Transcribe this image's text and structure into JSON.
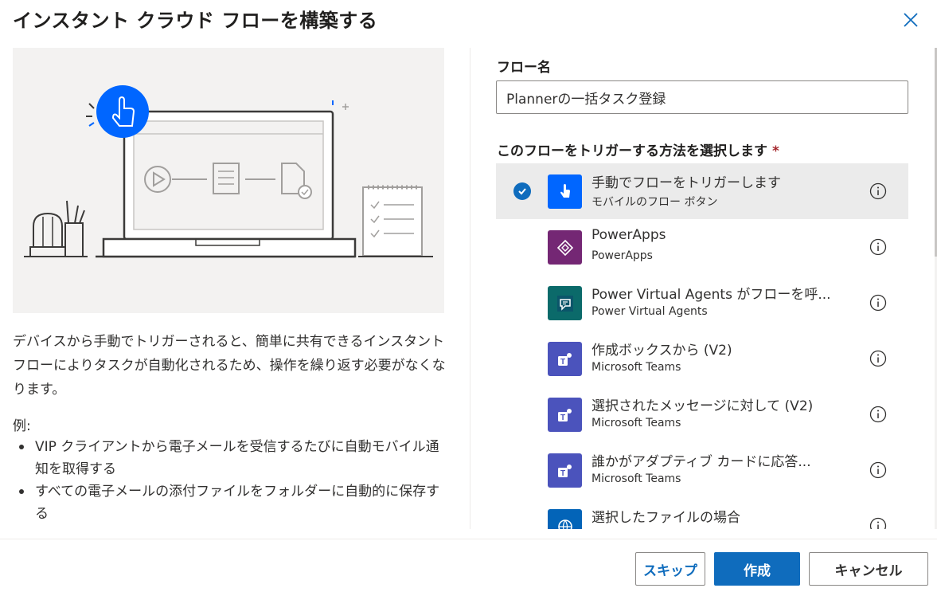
{
  "dialog": {
    "title": "インスタント クラウド フローを構築する",
    "close_icon": "close-icon"
  },
  "left": {
    "description": "デバイスから手動でトリガーされると、簡単に共有できるインスタント フローによりタスクが自動化されるため、操作を繰り返す必要がなくなります。",
    "examples_label": "例:",
    "examples": [
      "VIP クライアントから電子メールを受信するたびに自動モバイル通知を取得する",
      "すべての電子メールの添付ファイルをフォルダーに自動的に保存する"
    ]
  },
  "form": {
    "flow_name_label": "フロー名",
    "flow_name_value": "Plannerの一括タスク登録",
    "trigger_label": "このフローをトリガーする方法を選択します",
    "required_mark": "*"
  },
  "triggers": [
    {
      "title": "手動でフローをトリガーします",
      "subtitle": "モバイルのフロー ボタン",
      "icon": "touch-icon",
      "color": "#0066ff",
      "selected": true
    },
    {
      "title": "PowerApps",
      "subtitle": "PowerApps",
      "icon": "powerapps-icon",
      "color": "#742774",
      "selected": false
    },
    {
      "title": "Power Virtual Agents がフローを呼...",
      "subtitle": "Power Virtual Agents",
      "icon": "chat-bot-icon",
      "color": "#0b6a6a",
      "selected": false
    },
    {
      "title": "作成ボックスから (V2)",
      "subtitle": "Microsoft Teams",
      "icon": "teams-icon",
      "color": "#4b53bc",
      "selected": false
    },
    {
      "title": "選択されたメッセージに対して (V2)",
      "subtitle": "Microsoft Teams",
      "icon": "teams-icon",
      "color": "#4b53bc",
      "selected": false
    },
    {
      "title": "誰かがアダプティブ カードに応答...",
      "subtitle": "Microsoft Teams",
      "icon": "teams-icon",
      "color": "#4b53bc",
      "selected": false
    },
    {
      "title": "選択したファイルの場合",
      "subtitle": "",
      "icon": "onedrive-icon",
      "color": "#0364b8",
      "selected": false
    }
  ],
  "footer": {
    "skip_label": "スキップ",
    "create_label": "作成",
    "cancel_label": "キャンセル"
  },
  "colors": {
    "primary": "#0f6cbd",
    "selected_bg": "#ebebeb",
    "required": "#a4262c"
  }
}
